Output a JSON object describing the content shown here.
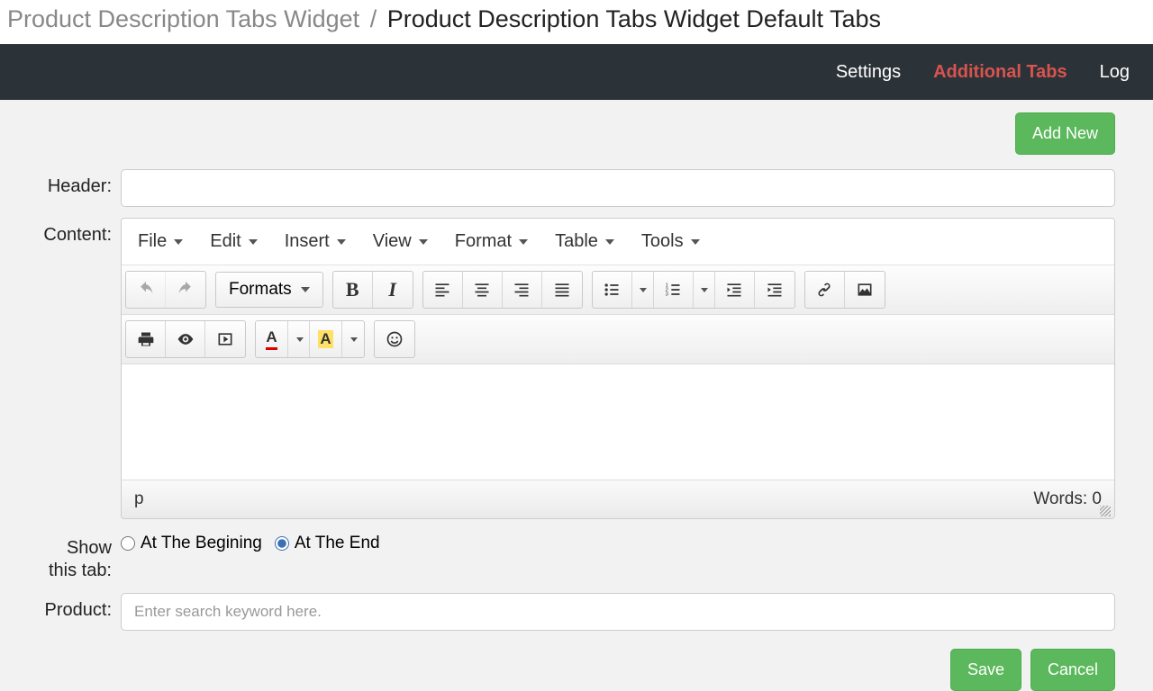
{
  "breadcrumb": {
    "parent": "Product Description Tabs Widget",
    "sep": "/",
    "current": "Product Description Tabs Widget Default Tabs"
  },
  "topnav": {
    "settings": "Settings",
    "additional_tabs": "Additional Tabs",
    "log": "Log"
  },
  "add_new": "Add New",
  "labels": {
    "header": "Header:",
    "content": "Content:",
    "show_tab_1": "Show",
    "show_tab_2": "this tab:",
    "product": "Product:"
  },
  "editor": {
    "menus": {
      "file": "File",
      "edit": "Edit",
      "insert": "Insert",
      "view": "View",
      "format": "Format",
      "table": "Table",
      "tools": "Tools"
    },
    "formats_label": "Formats",
    "status_path": "p",
    "words_label": "Words: 0"
  },
  "radio": {
    "begin": "At The Begining",
    "end": "At The End"
  },
  "product_placeholder": "Enter search keyword here.",
  "buttons": {
    "save": "Save",
    "cancel": "Cancel"
  }
}
